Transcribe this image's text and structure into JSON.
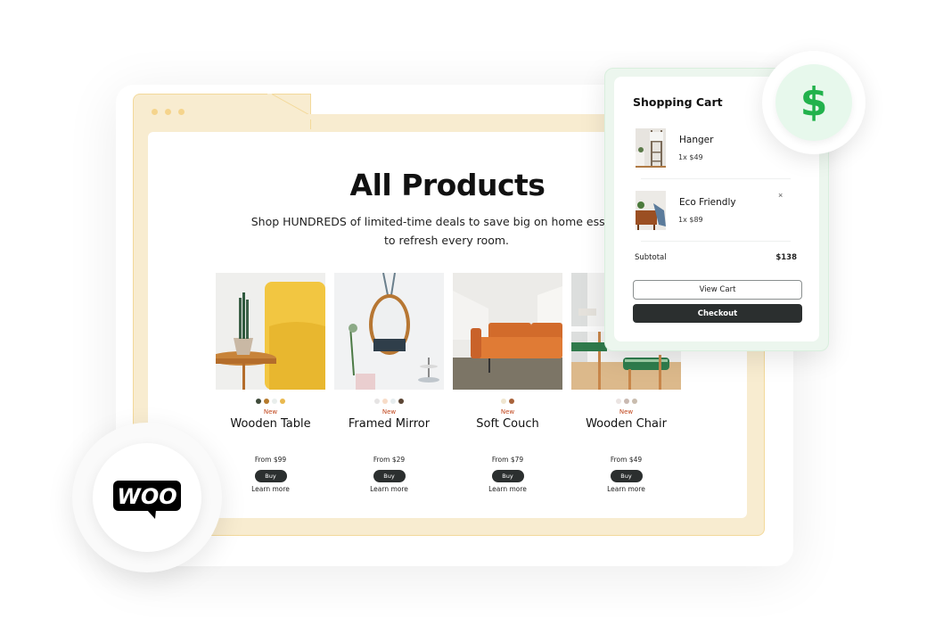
{
  "browser": {
    "window_dots": [
      "dot",
      "dot",
      "dot"
    ]
  },
  "page": {
    "title": "All Products",
    "subtitle": "Shop HUNDREDS of limited-time deals to save big on home essentials to refresh every room."
  },
  "products": [
    {
      "name": "Wooden Table",
      "badge": "New",
      "price": "From $99",
      "buy_label": "Buy",
      "learn_more": "Learn more",
      "swatches": [
        "#3f4b3a",
        "#b57a2c",
        "#e9eeec",
        "#e9b94f"
      ],
      "image": "yellow-chair-with-cactus-on-wooden-table"
    },
    {
      "name": "Framed Mirror",
      "badge": "New",
      "price": "From $29",
      "buy_label": "Buy",
      "learn_more": "Learn more",
      "swatches": [
        "#e6e4e4",
        "#f7dcc8",
        "#e6ecee",
        "#5b4534"
      ],
      "image": "round-framed-mirror-on-wall"
    },
    {
      "name": "Soft Couch",
      "badge": "New",
      "price": "From $79",
      "buy_label": "Buy",
      "learn_more": "Learn more",
      "swatches": [
        "#efe5cf",
        "#a8623a"
      ],
      "image": "orange-leather-couch"
    },
    {
      "name": "Wooden Chair",
      "badge": "New",
      "price": "From $49",
      "buy_label": "Buy",
      "learn_more": "Learn more",
      "swatches": [
        "#ebe4e2",
        "#c9b9b1",
        "#c9bcae"
      ],
      "image": "wooden-chair-with-leaf-cushion"
    }
  ],
  "cart": {
    "title": "Shopping Cart",
    "items": [
      {
        "name": "Hanger",
        "qty_price": "1x $49",
        "image": "ladder-hanger"
      },
      {
        "name": "Eco Friendly",
        "qty_price": "1x $89",
        "image": "wooden-sideboard",
        "remove_label": "×"
      }
    ],
    "subtotal_label": "Subtotal",
    "subtotal_value": "$138",
    "view_cart_label": "View Cart",
    "checkout_label": "Checkout"
  },
  "badges": {
    "dollar_symbol": "$",
    "woo_text": "WOO"
  },
  "colors": {
    "accent_green": "#22b24c",
    "frame_yellow": "#f8ecd0",
    "dark_button": "#2b2f2f",
    "new_badge": "#c0451b"
  }
}
